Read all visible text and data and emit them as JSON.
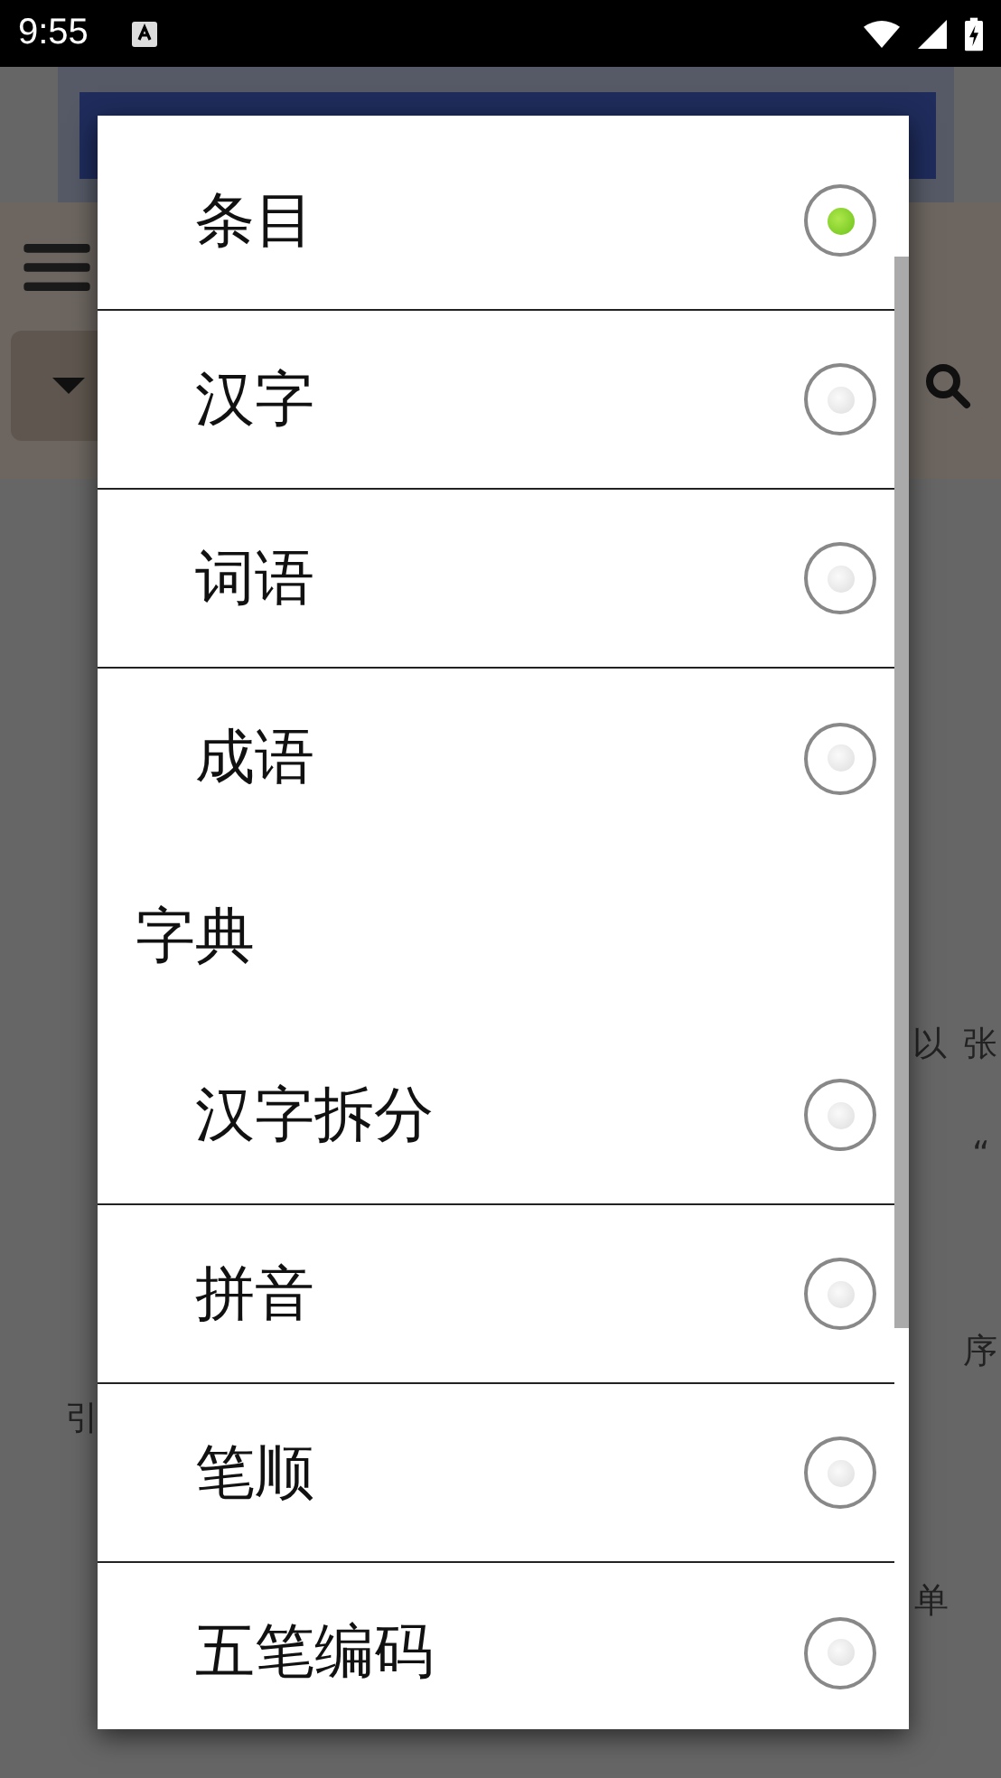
{
  "status_bar": {
    "time": "9:55"
  },
  "background": {
    "fragments": [
      {
        "text": "以"
      },
      {
        "text": "张"
      },
      {
        "text": "“"
      },
      {
        "text": "序"
      },
      {
        "text": "单"
      },
      {
        "text": "引"
      }
    ]
  },
  "dialog": {
    "items": [
      {
        "kind": "option",
        "label": "条目",
        "selected": true
      },
      {
        "kind": "option",
        "label": "汉字",
        "selected": false
      },
      {
        "kind": "option",
        "label": "词语",
        "selected": false
      },
      {
        "kind": "option",
        "label": "成语",
        "selected": false
      },
      {
        "kind": "header",
        "label": "字典"
      },
      {
        "kind": "option",
        "label": "汉字拆分",
        "selected": false
      },
      {
        "kind": "option",
        "label": "拼音",
        "selected": false
      },
      {
        "kind": "option",
        "label": "笔顺",
        "selected": false
      },
      {
        "kind": "option",
        "label": "五笔编码",
        "selected": false
      }
    ]
  }
}
